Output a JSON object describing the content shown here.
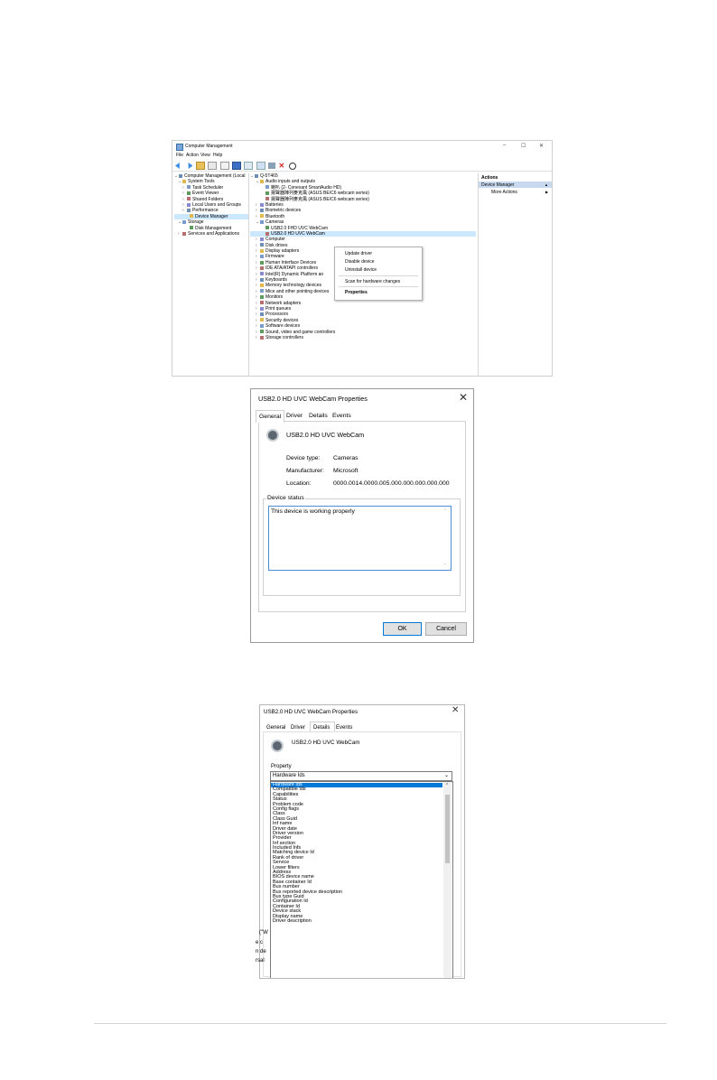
{
  "computer_management": {
    "title": "Computer Management",
    "window_controls": {
      "minimize": "–",
      "maximize": "☐",
      "close": "✕"
    },
    "menu": [
      "File",
      "Action",
      "View",
      "Help"
    ],
    "left_tree": [
      {
        "label": "Computer Management (Local",
        "chev": "⌄"
      },
      {
        "label": "System Tools",
        "chev": "⌄"
      },
      {
        "label": "Task Scheduler",
        "chev": "›"
      },
      {
        "label": "Event Viewer",
        "chev": "›"
      },
      {
        "label": "Shared Folders",
        "chev": "›"
      },
      {
        "label": "Local Users and Groups",
        "chev": "›"
      },
      {
        "label": "Performance",
        "chev": "›"
      },
      {
        "label": "Device Manager",
        "chev": ""
      },
      {
        "label": "Storage",
        "chev": "⌄"
      },
      {
        "label": "Disk Management",
        "chev": ""
      },
      {
        "label": "Services and Applications",
        "chev": "›"
      }
    ],
    "device_tree": [
      {
        "label": "Q-5T465",
        "chev": "⌄"
      },
      {
        "label": "Audio inputs and outputs",
        "chev": "⌄"
      },
      {
        "label": "喇叭 (2- Conexant SmartAudio HD)",
        "chev": ""
      },
      {
        "label": "揚聲器陣列麥克風 (ASUS BE/C6 webcam series)",
        "chev": ""
      },
      {
        "label": "揚聲器陣列麥克風 (ASUS BE/C6 webcam series)",
        "chev": ""
      },
      {
        "label": "Batteries",
        "chev": "›"
      },
      {
        "label": "Biometric devices",
        "chev": "›"
      },
      {
        "label": "Bluetooth",
        "chev": "›"
      },
      {
        "label": "Cameras",
        "chev": "⌄"
      },
      {
        "label": "USB2.0 FHD UVC WebCam",
        "chev": ""
      },
      {
        "label": "USB2.0 HD UVC WebCam",
        "chev": ""
      },
      {
        "label": "Computer",
        "chev": "›"
      },
      {
        "label": "Disk drives",
        "chev": "›"
      },
      {
        "label": "Display adapters",
        "chev": "›"
      },
      {
        "label": "Firmware",
        "chev": "›"
      },
      {
        "label": "Human Interface Devices",
        "chev": "›"
      },
      {
        "label": "IDE ATA/ATAPI controllers",
        "chev": "›"
      },
      {
        "label": "Intel(R) Dynamic Platform an",
        "chev": "›"
      },
      {
        "label": "Keyboards",
        "chev": "›"
      },
      {
        "label": "Memory technology devices",
        "chev": "›"
      },
      {
        "label": "Mice and other pointing devices",
        "chev": "›"
      },
      {
        "label": "Monitors",
        "chev": "›"
      },
      {
        "label": "Network adapters",
        "chev": "›"
      },
      {
        "label": "Print queues",
        "chev": "›"
      },
      {
        "label": "Processors",
        "chev": "›"
      },
      {
        "label": "Security devices",
        "chev": "›"
      },
      {
        "label": "Software devices",
        "chev": "›"
      },
      {
        "label": "Sound, video and game controllers",
        "chev": "›"
      },
      {
        "label": "Storage controllers",
        "chev": "›"
      }
    ],
    "actions": {
      "header": "Actions",
      "section": "Device Manager",
      "more": "More Actions",
      "section_arrow": "▲",
      "more_arrow": "▶"
    },
    "context_menu": [
      "Update driver",
      "Disable device",
      "Uninstall device",
      "Scan for hardware changes",
      "Properties"
    ]
  },
  "general_dialog": {
    "title": "USB2.0 HD UVC WebCam Properties",
    "close": "✕",
    "tabs": [
      "General",
      "Driver",
      "Details",
      "Events"
    ],
    "device_name": "USB2.0 HD UVC WebCam",
    "fields": [
      {
        "label": "Device type:",
        "value": "Cameras"
      },
      {
        "label": "Manufacturer:",
        "value": "Microsoft"
      },
      {
        "label": "Location:",
        "value": "0000.0014.0000.005.000.000.000.000.000"
      }
    ],
    "status_group": "Device status",
    "status_text": "This device is working properly",
    "ok": "OK",
    "cancel": "Cancel"
  },
  "details_dialog": {
    "title": "USB2.0 HD UVC WebCam Properties",
    "close": "✕",
    "tabs": [
      "General",
      "Driver",
      "Details",
      "Events"
    ],
    "device_name": "USB2.0 HD UVC WebCam",
    "property_label": "Property",
    "selected": "Hardware Ids",
    "options": [
      "Hardware Ids",
      "Compatible Ids",
      "Capabilities",
      "Status",
      "Problem code",
      "Config flags",
      "Class",
      "Class Guid",
      "Inf name",
      "Driver date",
      "Driver version",
      "Provider",
      "Inf section",
      "Included Infs",
      "Matching device Id",
      "Rank of driver",
      "Service",
      "Lower filters",
      "Address",
      "BIOS device name",
      "Base container Id",
      "Bus number",
      "Bus reported device description",
      "Bus type Guid",
      "Configuration Id",
      "Container Id",
      "Device stack",
      "Display name",
      "Driver description"
    ],
    "left_fragments": [
      "(\"W",
      "e c",
      "n de",
      "rsal"
    ]
  }
}
